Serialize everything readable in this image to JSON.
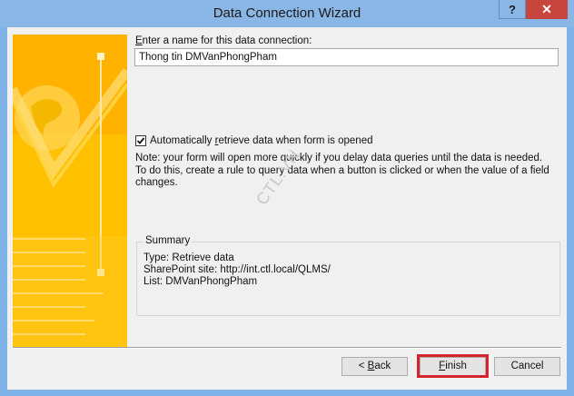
{
  "window": {
    "title": "Data Connection Wizard",
    "help_label": "?",
    "close_label": "✕"
  },
  "form": {
    "name_label_underlined": "E",
    "name_label_rest": "nter a name for this data connection:",
    "name_value": "Thong tin DMVanPhongPham",
    "checkbox_checked": true,
    "checkbox_label_before": "Automatically ",
    "checkbox_label_underlined": "r",
    "checkbox_label_after": "etrieve data when form is opened",
    "note_line1": "Note: your form will open more quickly if you delay data queries until the data is needed.",
    "note_line2": "To do this, create a rule to query data when a button is clicked or when the value of a field",
    "note_line3": "changes."
  },
  "watermark": "CTL.VN",
  "summary": {
    "heading": "Summary",
    "type_line": "Type: Retrieve data",
    "site_line": "SharePoint site: http://int.ctl.local/QLMS/",
    "list_line": "List: DMVanPhongPham"
  },
  "buttons": {
    "back_prefix": "< ",
    "back_underlined": "B",
    "back_rest": "ack",
    "finish_underlined": "F",
    "finish_rest": "inish",
    "cancel_label": "Cancel"
  },
  "colors": {
    "highlight": "#d6232b",
    "art_yellow": "#ffc000",
    "titlebar": "#8ab6e6",
    "close": "#c7453c"
  }
}
